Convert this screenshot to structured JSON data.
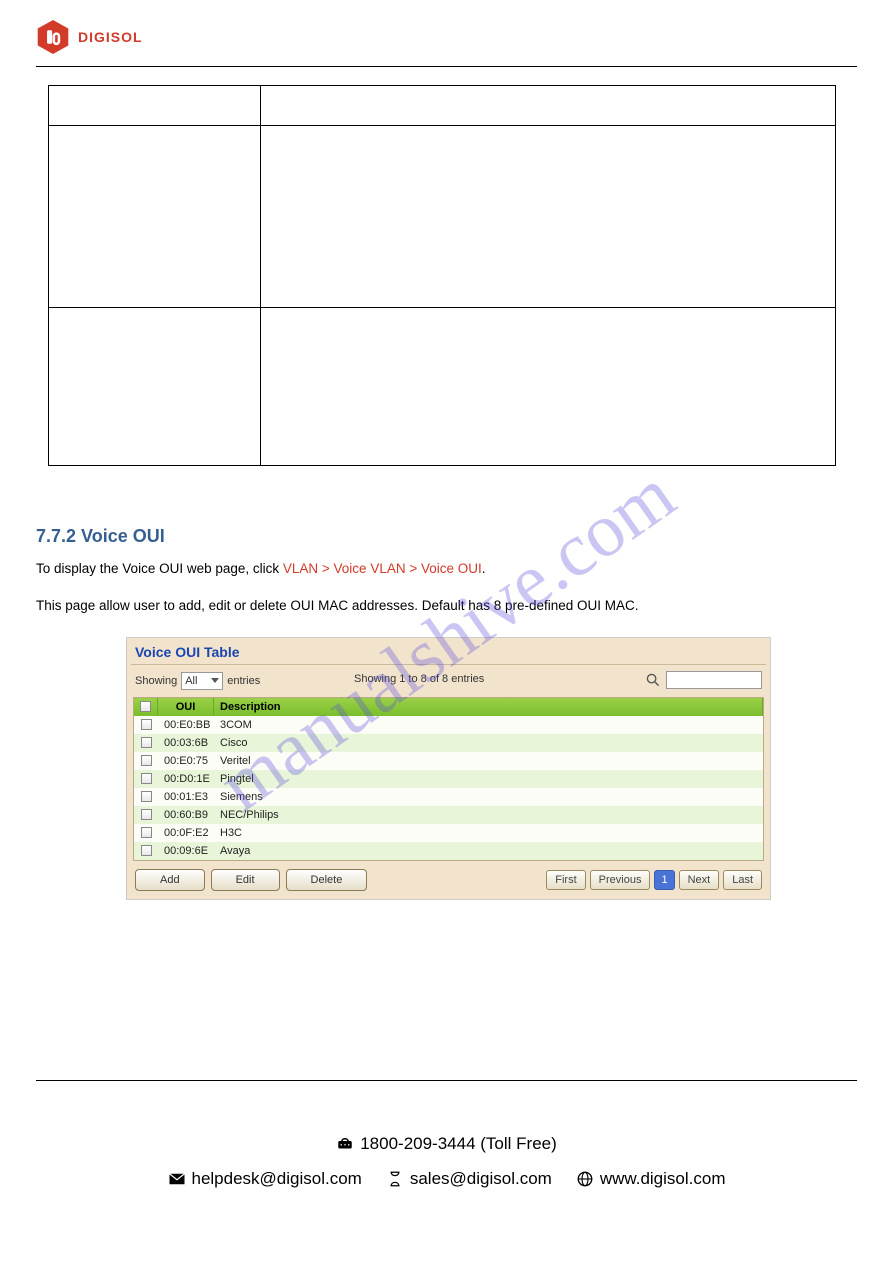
{
  "brand": "DIGISOL",
  "watermark": "manualshive.com",
  "table_rows": [
    {
      "k": "",
      "v": ""
    },
    {
      "k": "",
      "v": ""
    },
    {
      "k": "",
      "v": ""
    }
  ],
  "section_heading": "7.7.2 Voice OUI",
  "paragraph1_a": "To display the Voice OUI web page, click ",
  "paragraph1_b": "VLAN > Voice VLAN > Voice OUI",
  "paragraph1_c": ".",
  "paragraph2": "This page allow user to add, edit or delete OUI MAC addresses. Default has 8 pre-defined OUI MAC.",
  "screenshot": {
    "title": "Voice OUI Table",
    "showing_label": "Showing",
    "select_value": "All",
    "entries_label": "entries",
    "count_info": "Showing 1 to 8 of 8 entries",
    "search_placeholder": "",
    "headers": {
      "oui": "OUI",
      "desc": "Description"
    },
    "rows": [
      {
        "oui": "00:E0:BB",
        "desc": "3COM"
      },
      {
        "oui": "00:03:6B",
        "desc": "Cisco"
      },
      {
        "oui": "00:E0:75",
        "desc": "Veritel"
      },
      {
        "oui": "00:D0:1E",
        "desc": "Pingtel"
      },
      {
        "oui": "00:01:E3",
        "desc": "Siemens"
      },
      {
        "oui": "00:60:B9",
        "desc": "NEC/Philips"
      },
      {
        "oui": "00:0F:E2",
        "desc": "H3C"
      },
      {
        "oui": "00:09:6E",
        "desc": "Avaya"
      }
    ],
    "buttons": {
      "add": "Add",
      "edit": "Edit",
      "delete": "Delete"
    },
    "pager": {
      "first": "First",
      "prev": "Previous",
      "page": "1",
      "next": "Next",
      "last": "Last"
    }
  },
  "footer": {
    "phone_line": "1800-209-3444 (Toll Free)",
    "helpdesk": "helpdesk@digisol.com",
    "sales": "sales@digisol.com",
    "web": "www.digisol.com"
  }
}
